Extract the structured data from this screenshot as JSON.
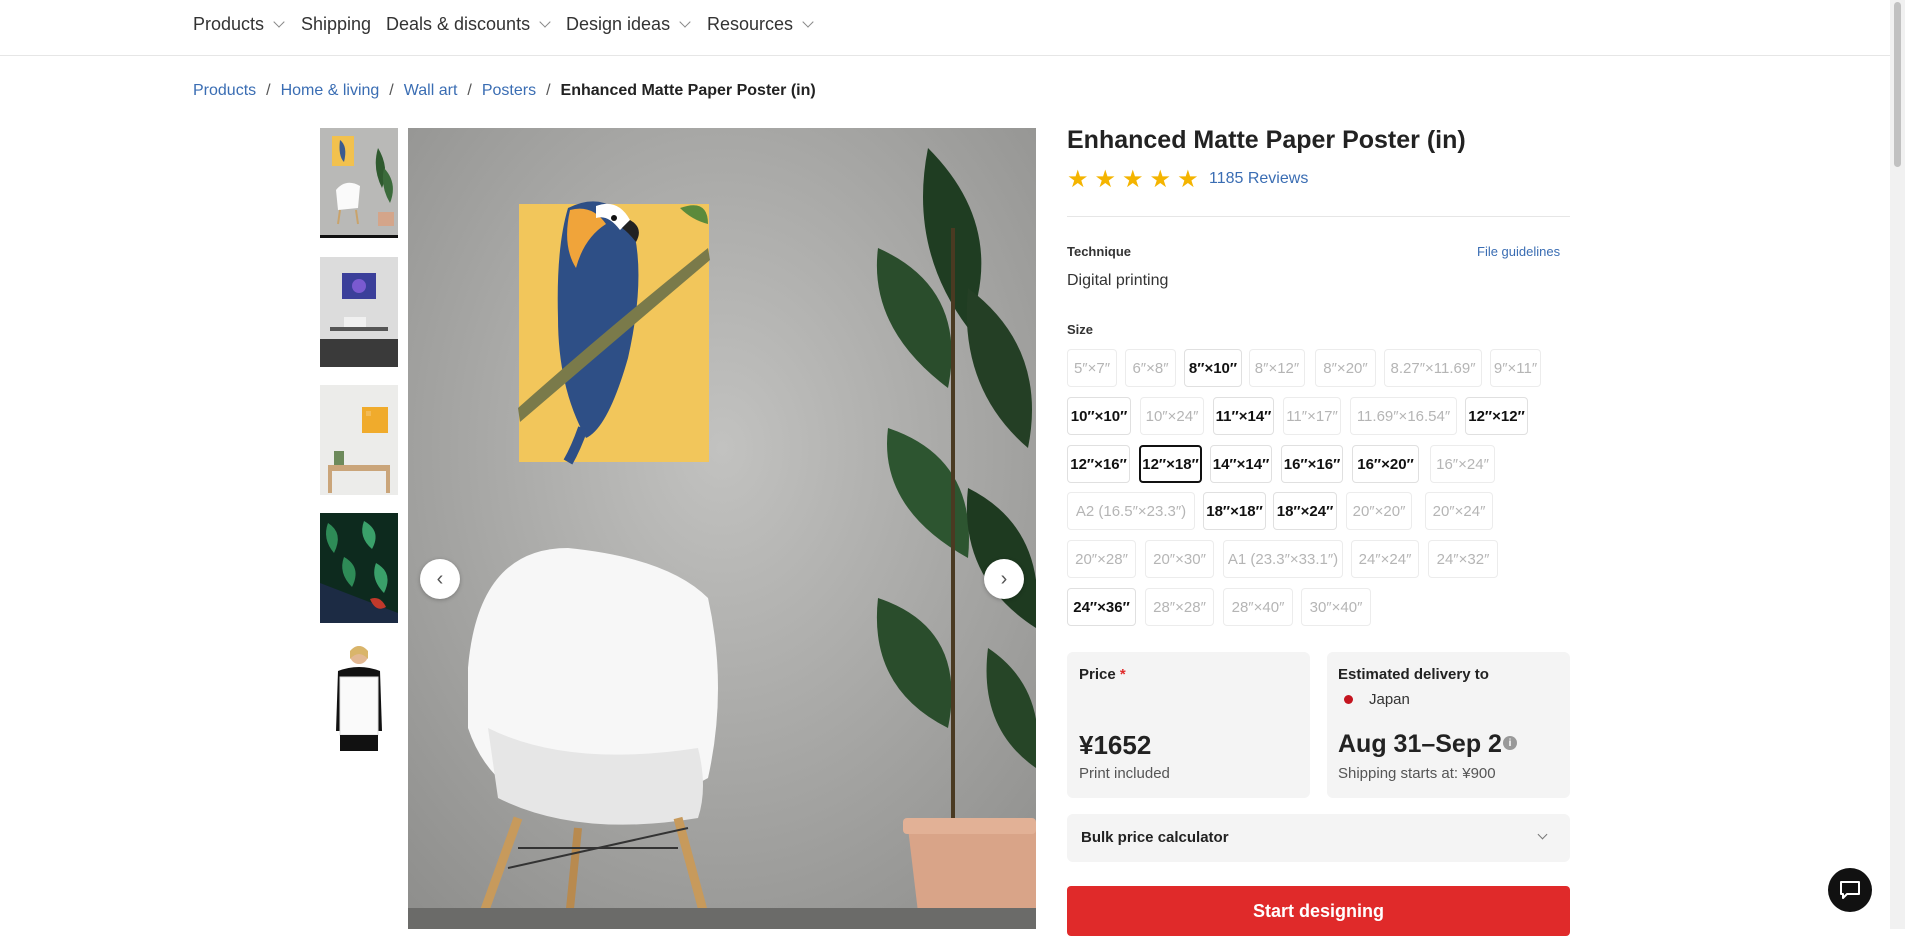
{
  "nav": {
    "items": [
      {
        "label": "Products",
        "dropdown": true
      },
      {
        "label": "Shipping",
        "dropdown": false
      },
      {
        "label": "Deals & discounts",
        "dropdown": true
      },
      {
        "label": "Design ideas",
        "dropdown": true
      },
      {
        "label": "Resources",
        "dropdown": true
      }
    ]
  },
  "breadcrumb": {
    "items": [
      "Products",
      "Home & living",
      "Wall art",
      "Posters"
    ],
    "current": "Enhanced Matte Paper Poster (in)"
  },
  "gallery": {
    "thumbnails": [
      "parrot-poster-with-chair",
      "poster-over-desk",
      "poster-over-shelf",
      "leaf-pattern-poster",
      "person-holding-poster"
    ],
    "active_index": 0
  },
  "product": {
    "title": "Enhanced Matte Paper Poster (in)",
    "rating_stars": 5,
    "reviews": "1185 Reviews",
    "technique_label": "Technique",
    "file_guidelines": "File guidelines",
    "technique_value": "Digital printing",
    "size_label": "Size",
    "sizes": [
      {
        "label": "5″×7″",
        "state": "disabled"
      },
      {
        "label": "6″×8″",
        "state": "disabled"
      },
      {
        "label": "8″×10″",
        "state": "available"
      },
      {
        "label": "8″×12″",
        "state": "disabled"
      },
      {
        "label": "8″×20″",
        "state": "disabled"
      },
      {
        "label": "8.27″×11.69″",
        "state": "disabled"
      },
      {
        "label": "9″×11″",
        "state": "disabled"
      },
      {
        "label": "10″×10″",
        "state": "available"
      },
      {
        "label": "10″×24″",
        "state": "disabled"
      },
      {
        "label": "11″×14″",
        "state": "available"
      },
      {
        "label": "11″×17″",
        "state": "disabled"
      },
      {
        "label": "11.69″×16.54″",
        "state": "disabled"
      },
      {
        "label": "12″×12″",
        "state": "available"
      },
      {
        "label": "12″×16″",
        "state": "available"
      },
      {
        "label": "12″×18″",
        "state": "selected"
      },
      {
        "label": "14″×14″",
        "state": "available"
      },
      {
        "label": "16″×16″",
        "state": "available"
      },
      {
        "label": "16″×20″",
        "state": "available"
      },
      {
        "label": "16″×24″",
        "state": "disabled"
      },
      {
        "label": "A2 (16.5″×23.3″)",
        "state": "disabled"
      },
      {
        "label": "18″×18″",
        "state": "available"
      },
      {
        "label": "18″×24″",
        "state": "available"
      },
      {
        "label": "20″×20″",
        "state": "disabled"
      },
      {
        "label": "20″×24″",
        "state": "disabled"
      },
      {
        "label": "20″×28″",
        "state": "disabled"
      },
      {
        "label": "20″×30″",
        "state": "disabled"
      },
      {
        "label": "A1 (23.3″×33.1″)",
        "state": "disabled"
      },
      {
        "label": "24″×24″",
        "state": "disabled"
      },
      {
        "label": "24″×32″",
        "state": "disabled"
      },
      {
        "label": "24″×36″",
        "state": "available"
      },
      {
        "label": "28″×28″",
        "state": "disabled"
      },
      {
        "label": "28″×40″",
        "state": "disabled"
      },
      {
        "label": "30″×40″",
        "state": "disabled"
      }
    ]
  },
  "price": {
    "label": "Price",
    "required_mark": "*",
    "value": "¥1652",
    "note": "Print included"
  },
  "delivery": {
    "label": "Estimated delivery to",
    "country": "Japan",
    "dates": "Aug 31–Sep 2",
    "shipping": "Shipping starts at: ¥900"
  },
  "bulk": {
    "label": "Bulk price calculator"
  },
  "cta": {
    "label": "Start designing"
  },
  "colors": {
    "accent": "#e02a2a",
    "link": "#3a6db3",
    "star": "#f4b400"
  }
}
